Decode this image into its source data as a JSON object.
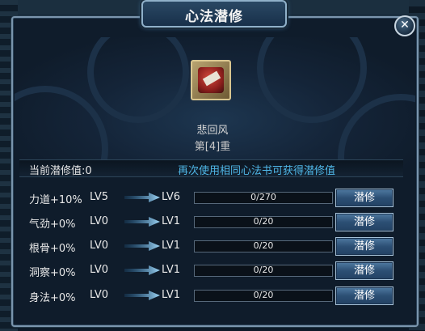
{
  "window": {
    "title": "心法潜修",
    "close_symbol": "✕"
  },
  "skill": {
    "icon": "red-book-icon",
    "name": "悲回风",
    "tier": "第[4]重"
  },
  "info": {
    "current_value": "当前潜修值:0",
    "hint": "再次使用相同心法书可获得潜修值"
  },
  "rows": [
    {
      "stat": "力道+10%",
      "from": "LV5",
      "to": "LV6",
      "progress_text": "0/270",
      "progress": 0,
      "button": "潜修"
    },
    {
      "stat": "气劲+0%",
      "from": "LV0",
      "to": "LV1",
      "progress_text": "0/20",
      "progress": 0,
      "button": "潜修"
    },
    {
      "stat": "根骨+0%",
      "from": "LV0",
      "to": "LV1",
      "progress_text": "0/20",
      "progress": 0,
      "button": "潜修"
    },
    {
      "stat": "洞察+0%",
      "from": "LV0",
      "to": "LV1",
      "progress_text": "0/20",
      "progress": 0,
      "button": "潜修"
    },
    {
      "stat": "身法+0%",
      "from": "LV0",
      "to": "LV1",
      "progress_text": "0/20",
      "progress": 0,
      "button": "潜修"
    }
  ],
  "colors": {
    "accent_blue": "#4fb6e6",
    "button_blue": "#2c4f74"
  }
}
